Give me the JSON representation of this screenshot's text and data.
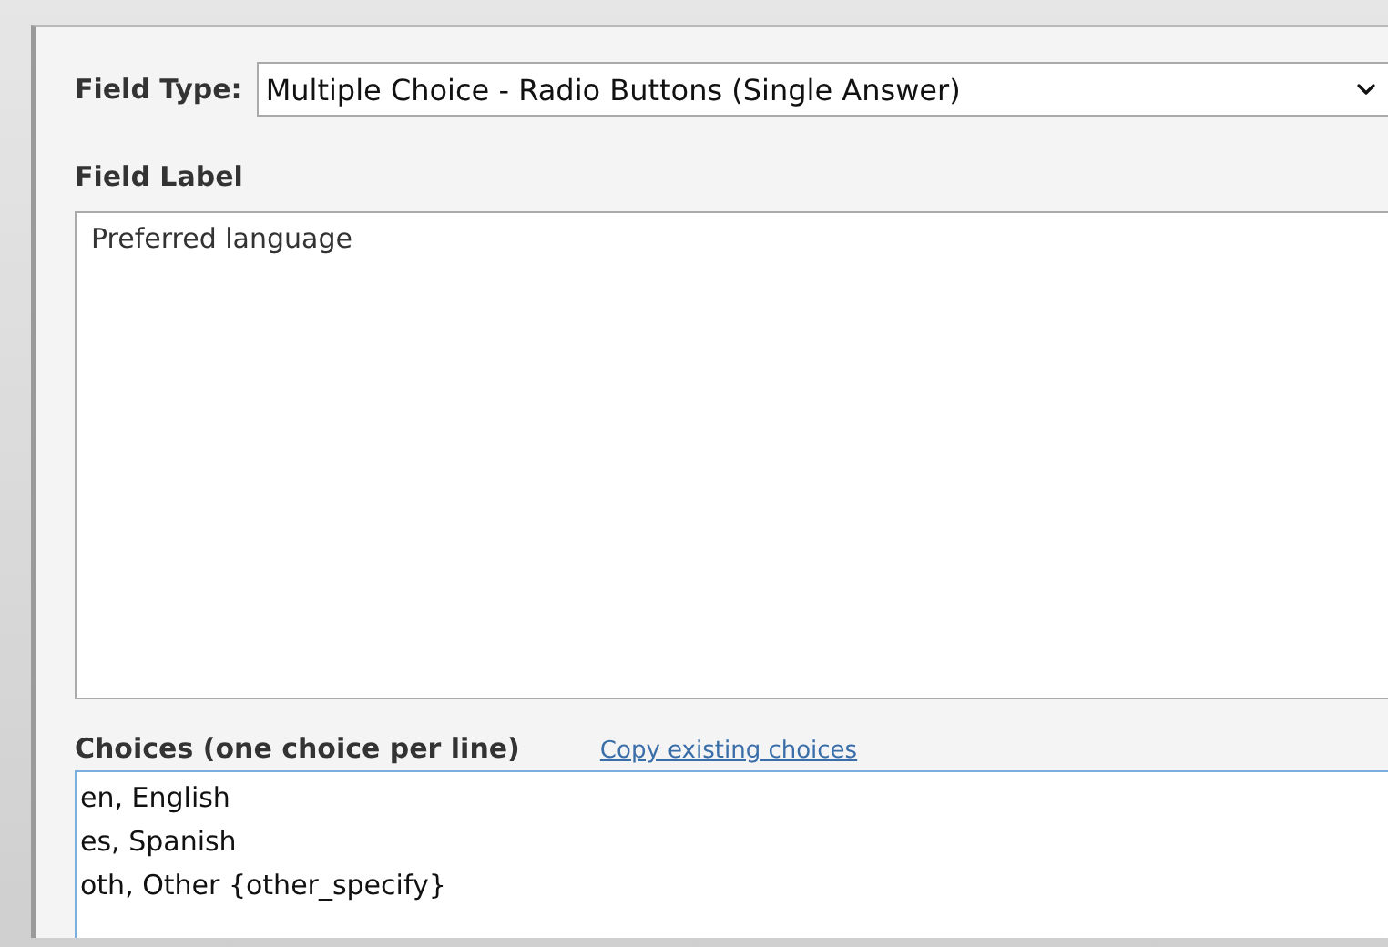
{
  "field_type": {
    "label": "Field Type:",
    "value": "Multiple Choice - Radio Buttons (Single Answer)"
  },
  "field_label": {
    "label": "Field Label",
    "value": "Preferred language"
  },
  "choices": {
    "label": "Choices (one choice per line)",
    "link": "Copy existing choices",
    "focused": true,
    "lines": [
      "en, English",
      "es, Spanish",
      "oth, Other {other_specify}"
    ]
  }
}
